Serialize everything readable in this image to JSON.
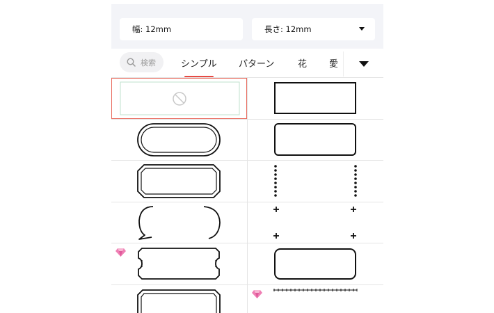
{
  "header": {
    "width_label": "幅: 12mm",
    "length_label": "長さ: 12mm"
  },
  "tabs": {
    "search_placeholder": "検索",
    "items": [
      "シンプル",
      "パターン",
      "花",
      "愛"
    ],
    "active": "シンプル",
    "accent_color": "#e74a44"
  },
  "grid": {
    "items": [
      {
        "frame": "none",
        "selected": true,
        "premium": false
      },
      {
        "frame": "rectangle",
        "selected": false,
        "premium": false
      },
      {
        "frame": "pill-double",
        "selected": false,
        "premium": false
      },
      {
        "frame": "rounded-rectangle",
        "selected": false,
        "premium": false
      },
      {
        "frame": "octagon-double",
        "selected": false,
        "premium": false
      },
      {
        "frame": "dotted-sides",
        "selected": false,
        "premium": false
      },
      {
        "frame": "speech-bubble",
        "selected": false,
        "premium": false
      },
      {
        "frame": "plus-corners",
        "selected": false,
        "premium": false
      },
      {
        "frame": "ticket",
        "selected": false,
        "premium": true
      },
      {
        "frame": "rounded-rectangle-wide",
        "selected": false,
        "premium": false
      },
      {
        "frame": "cut-corner-double",
        "selected": false,
        "premium": false
      },
      {
        "frame": "plus-line",
        "selected": false,
        "premium": true
      }
    ]
  }
}
